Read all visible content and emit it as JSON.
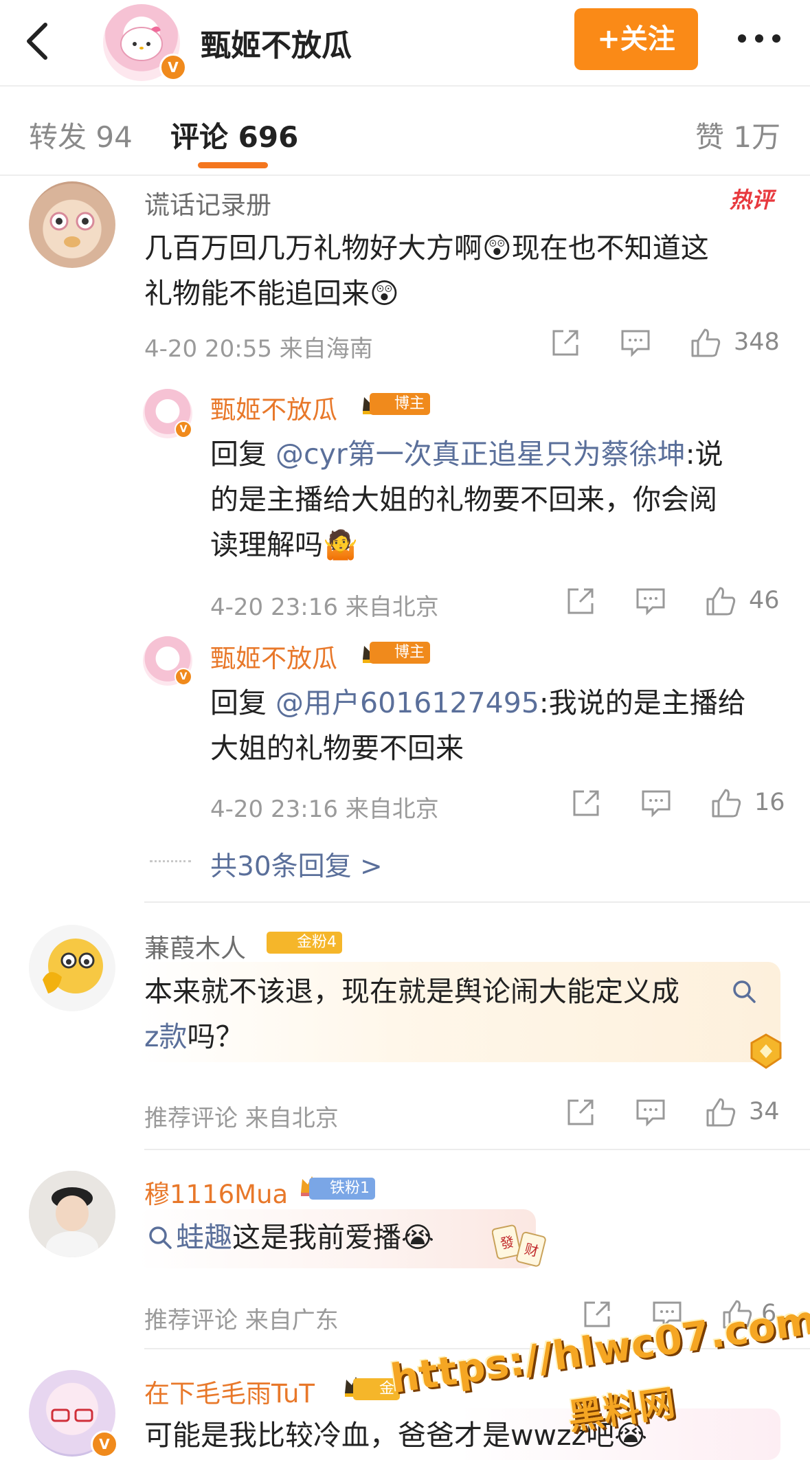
{
  "header": {
    "name": "甄姬不放瓜",
    "follow_label": "+关注",
    "verified_mark": "V"
  },
  "tabs": [
    {
      "label": "转发 94"
    },
    {
      "label": "评论 696"
    },
    {
      "label": "赞 1万"
    }
  ],
  "hot_tag": "热评",
  "comments": [
    {
      "user": "谎话记录册",
      "text1": "几百万回几万礼物好大方啊😲现在也不知道这",
      "text2": "礼物能不能追回来😲",
      "meta": "4-20 20:55  来自海南",
      "likes": "348",
      "replies": [
        {
          "user": "甄姬不放瓜",
          "badge": "博主",
          "prefix": "回复 ",
          "mention": "@cyr第一次真正追星只为蔡徐坤",
          "line1_rest": ":说",
          "line2": "的是主播给大姐的礼物要不回来，你会阅",
          "line3": "读理解吗🤷",
          "meta": "4-20 23:16  来自北京",
          "likes": "46"
        },
        {
          "user": "甄姬不放瓜",
          "badge": "博主",
          "prefix": "回复 ",
          "mention": "@用户6016127495",
          "line1_rest": ":我说的是主播给",
          "line2": "大姐的礼物要不回来",
          "meta": "4-20 23:16  来自北京",
          "likes": "16"
        }
      ],
      "more_replies": "共30条回复 >"
    },
    {
      "user": "蒹葭木人",
      "badge": "金粉4",
      "text1": "本来就不该退，现在就是舆论闹大能定义成",
      "link_word": "z款",
      "text2_rest": "吗？",
      "meta": "推荐评论  来自北京",
      "likes": "34"
    },
    {
      "user": "穆1116Mua",
      "badge": "铁粉1",
      "link_word": "蛙趣",
      "text_rest": "这是我前爱播😭",
      "meta": "推荐评论  来自广东",
      "likes": "6"
    },
    {
      "user": "在下毛毛雨TuT",
      "badge": "金",
      "text": "可能是我比较冷血，爸爸才是wwzz吧😭"
    }
  ],
  "watermark": {
    "line1": "https://hlwc07.com",
    "line2": "黑料网"
  },
  "colors": {
    "accent_orange": "#fa8a17",
    "name_orange": "#e8782a",
    "mention_blue": "#5a6f9a",
    "hot_red": "#e8393e"
  },
  "icons": [
    "back-icon",
    "more-icon",
    "share-icon",
    "comment-icon",
    "like-icon",
    "crown-icon",
    "search-icon",
    "verified-icon"
  ]
}
